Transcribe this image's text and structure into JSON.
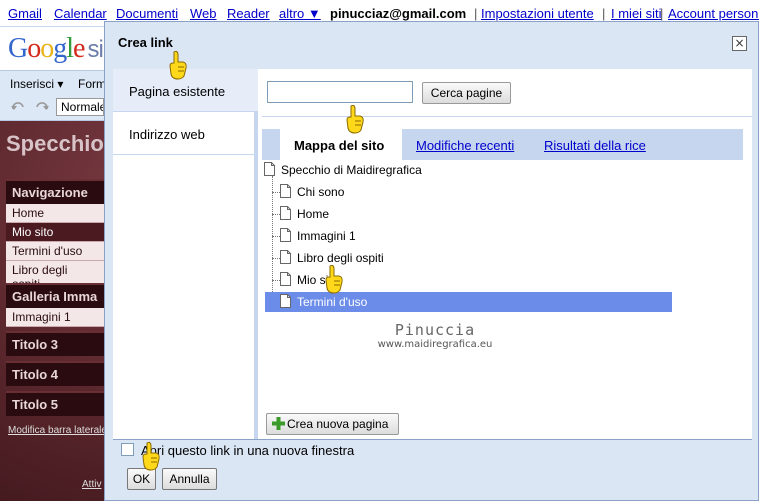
{
  "gbar": {
    "gmail": "Gmail",
    "calendar": "Calendar",
    "documents": "Documenti",
    "web": "Web",
    "reader": "Reader",
    "more": "altro ▼",
    "email": "pinucciaz@gmail.com",
    "settings": "Impostazioni utente",
    "my_sites": "I miei siti",
    "account": "Account personale",
    "separator": "|"
  },
  "background": {
    "logo_suffix": "si",
    "toolbar_insert": "Inserisci ▾",
    "toolbar_format": "Form",
    "toolbar_style": "Normale",
    "site_title": "Specchio",
    "sidebar": {
      "nav_heading": "Navigazione",
      "nav_items": [
        "Home",
        "Mio sito",
        "Termini d'uso",
        "Libro degli ospiti"
      ],
      "gallery_heading": "Galleria Imma",
      "gallery_items": [
        "Immagini 1"
      ],
      "title3": "Titolo 3",
      "title4": "Titolo 4",
      "title5": "Titolo 5",
      "edit_link": "Modifica barra laterale",
      "activity_link": "Attiv"
    }
  },
  "dialog": {
    "title": "Crea link",
    "close": "×",
    "nav": [
      "Pagina esistente",
      "Indirizzo web"
    ],
    "search": {
      "placeholder": "",
      "value": "",
      "button": "Cerca pagine"
    },
    "tabs": [
      "Mappa del sito",
      "Modifiche recenti",
      "Risultati della rice"
    ],
    "tree": {
      "root": "Specchio di Maidiregrafica",
      "children": [
        "Chi sono",
        "Home",
        "Immagini 1",
        "Libro degli ospiti",
        "Mio sito",
        "Termini d'uso"
      ],
      "selected": "Termini d'uso"
    },
    "watermark": {
      "name": "Pinuccia",
      "url": "www.maidiregrafica.eu"
    },
    "new_page_button": "Crea nuova pagina",
    "new_window_label": "Apri questo link in una nuova finestra",
    "ok": "OK",
    "cancel": "Annulla"
  },
  "colors": {
    "dialog_bg": "#dbe6f5",
    "selection": "#6b8ce8",
    "link": "#0000cc",
    "tab_bar": "#c6d6ee"
  }
}
